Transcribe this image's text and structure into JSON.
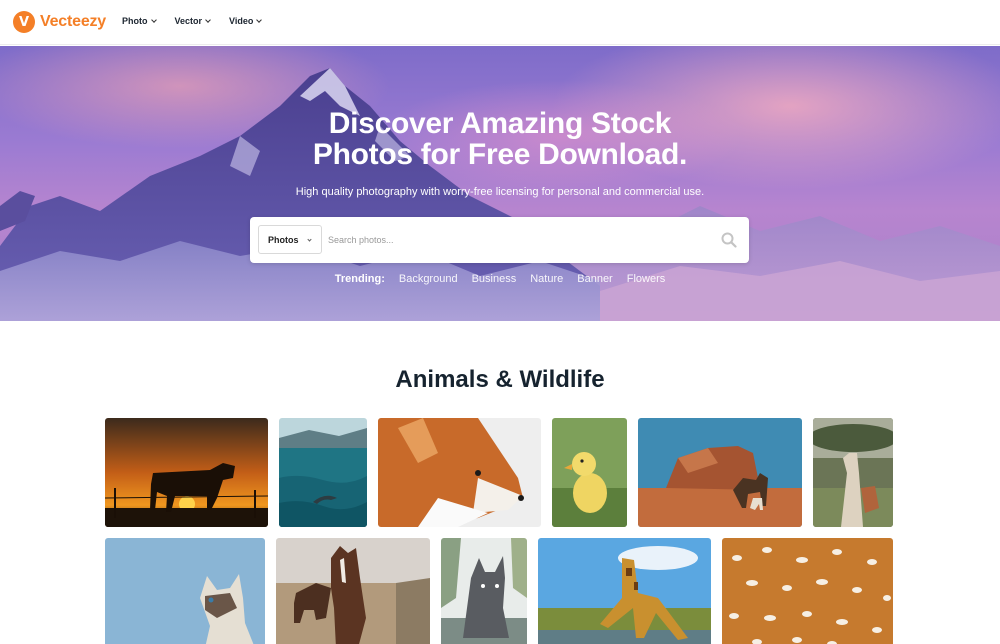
{
  "header": {
    "logo_text": "Vecteezy",
    "logo_mark": "V",
    "nav": [
      {
        "label": "Photo"
      },
      {
        "label": "Vector"
      },
      {
        "label": "Video"
      }
    ]
  },
  "hero": {
    "title_line1": "Discover Amazing Stock",
    "title_line2": "Photos for Free Download.",
    "subtitle": "High quality photography with worry-free licensing for personal and commercial use.",
    "search": {
      "type_selected": "Photos",
      "placeholder": "Search photos..."
    },
    "trending_label": "Trending:",
    "trending": [
      "Background",
      "Business",
      "Nature",
      "Banner",
      "Flowers"
    ]
  },
  "section": {
    "title": "Animals & Wildlife"
  },
  "photos": [
    {
      "subject": "cow-silhouette-sunset"
    },
    {
      "subject": "dolphin-ocean"
    },
    {
      "subject": "fox"
    },
    {
      "subject": "duckling"
    },
    {
      "subject": "camel-desert"
    },
    {
      "subject": "llama-field"
    },
    {
      "subject": "siamese-cat"
    },
    {
      "subject": "horse"
    },
    {
      "subject": "dog-stream"
    },
    {
      "subject": "giraffe-drinking"
    },
    {
      "subject": "deer-fur-spots"
    }
  ],
  "colors": {
    "brand": "#f47f27",
    "heading": "#16232f"
  },
  "icons": [
    "logo-mark",
    "chevron-down-icon",
    "search-icon"
  ]
}
